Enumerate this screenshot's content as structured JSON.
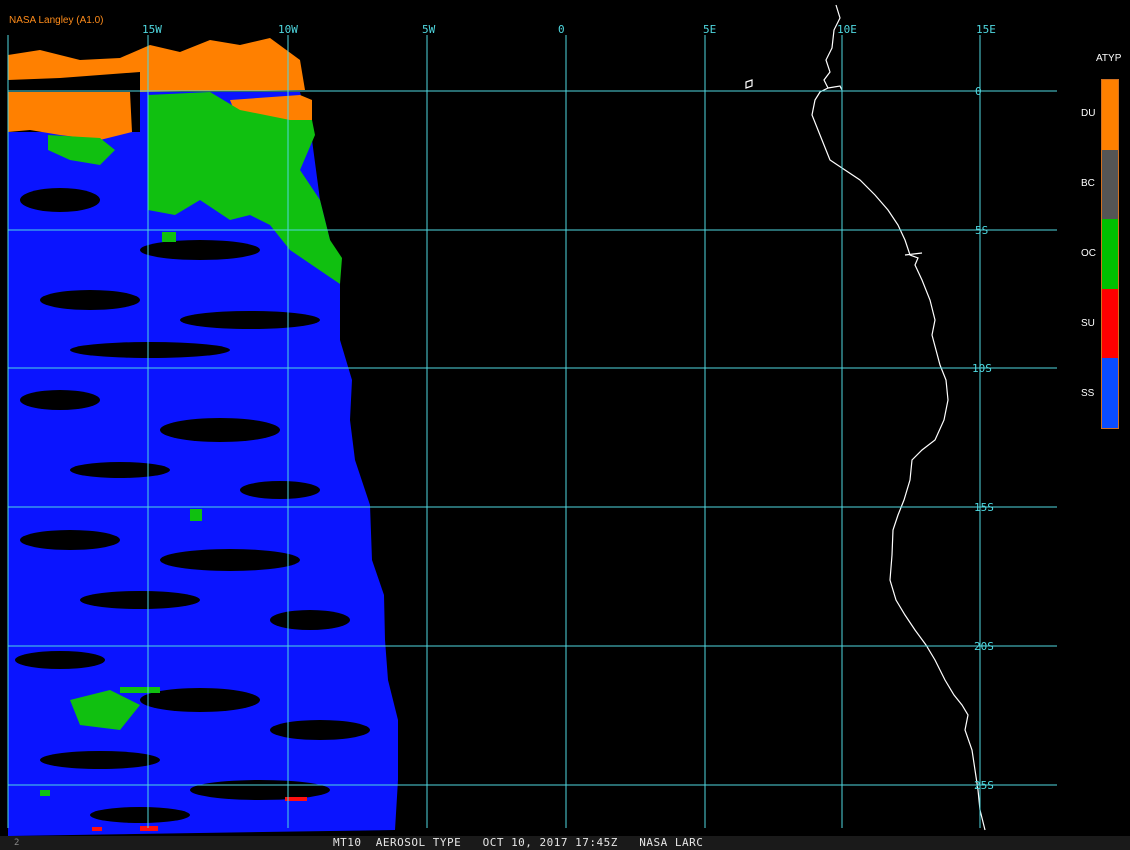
{
  "credit": "NASA Langley (A1.0)",
  "status_bar": {
    "frame_number": "2",
    "text": "MT10  AEROSOL TYPE   OCT 10, 2017 17:45Z   NASA LARC"
  },
  "grid": {
    "longitude_labels": [
      "15W",
      "10W",
      "5W",
      "0",
      "5E",
      "10E",
      "15E"
    ],
    "latitude_labels": [
      "0",
      "5S",
      "10S",
      "15S",
      "20S",
      "25S"
    ],
    "line_color": "#4fd8e0"
  },
  "legend": {
    "title": "ATYP",
    "entries": [
      {
        "label": "DU",
        "color": "#ff8000"
      },
      {
        "label": "BC",
        "color": "#555555"
      },
      {
        "label": "OC",
        "color": "#00c000"
      },
      {
        "label": "SU",
        "color": "#ff0000"
      },
      {
        "label": "SS",
        "color": "#0a4cff"
      }
    ]
  },
  "colors": {
    "sea_salt": "#0a14ff",
    "organic_carbon": "#10c010",
    "dust": "#ff8000",
    "sulfate": "#ff1010",
    "coastline": "#ffffff"
  }
}
